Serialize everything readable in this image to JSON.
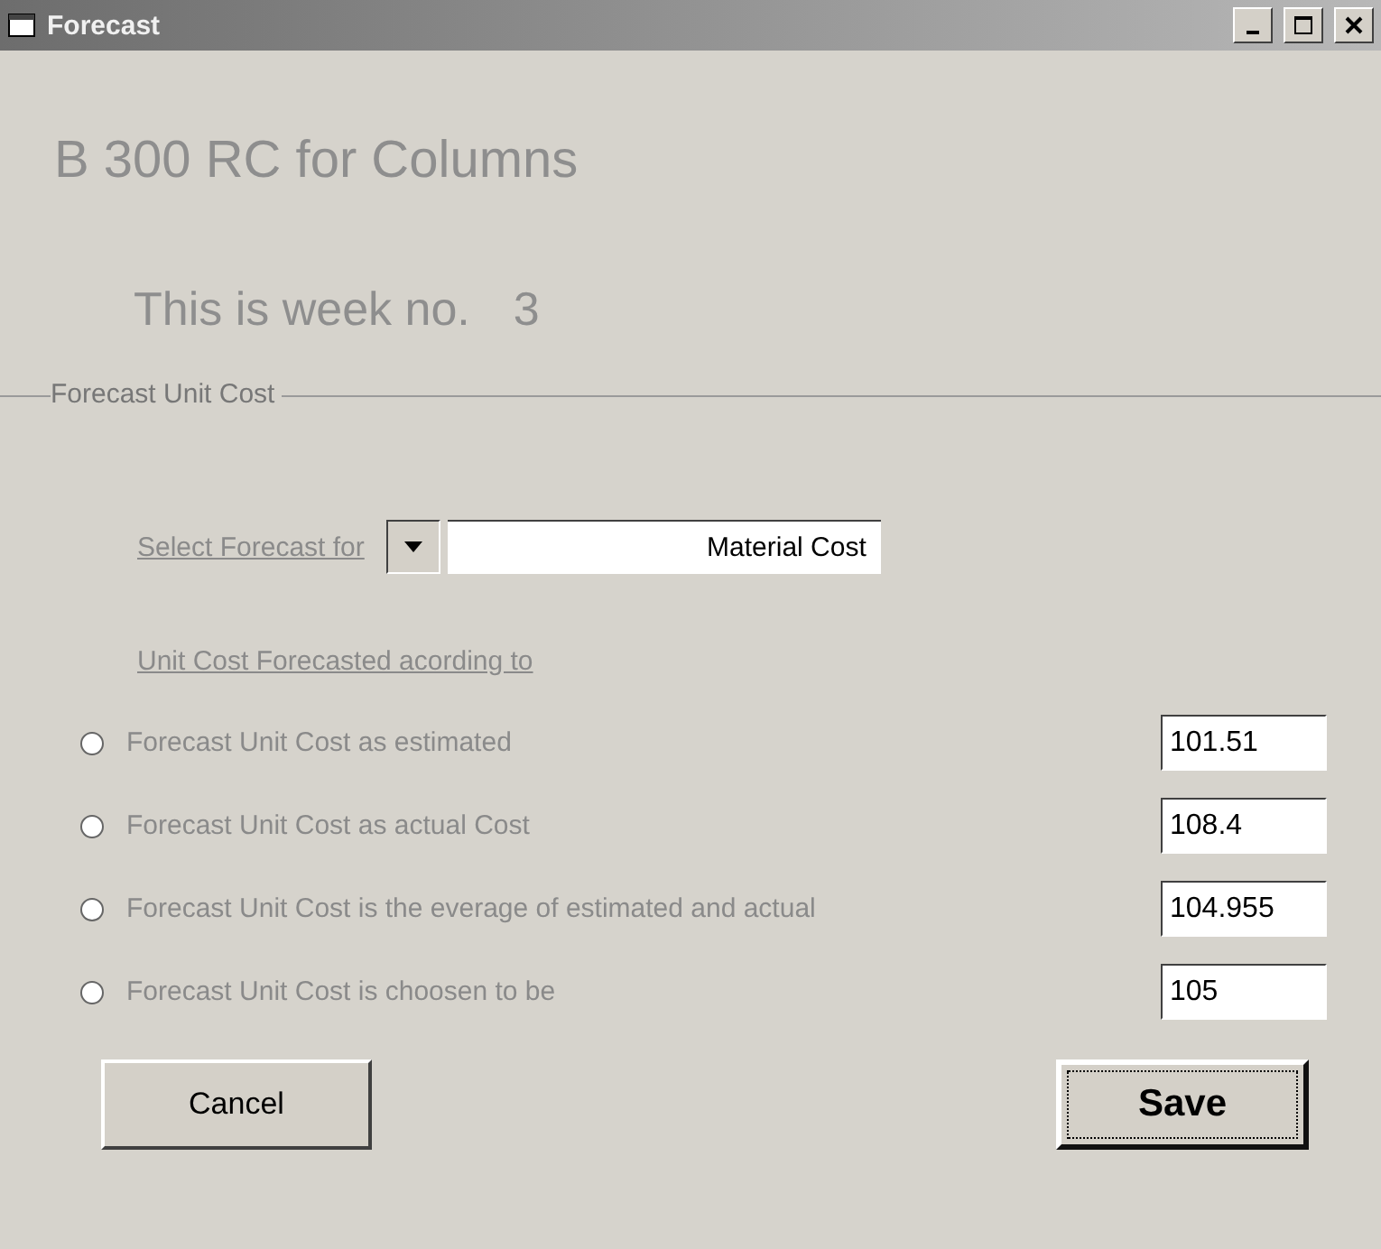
{
  "window": {
    "title": "Forecast"
  },
  "heading": "B 300 RC for Columns",
  "week": {
    "label": "This is week no.",
    "value": "3"
  },
  "group": {
    "title": "Forecast Unit Cost",
    "select": {
      "label": "Select Forecast for",
      "value": "Material Cost"
    },
    "options_label": "Unit Cost Forecasted acording to",
    "options": [
      {
        "label": "Forecast Unit Cost as estimated",
        "value": "101.51",
        "selected": false
      },
      {
        "label": "Forecast Unit Cost as actual Cost",
        "value": "108.4",
        "selected": false
      },
      {
        "label": "Forecast Unit Cost is the everage of estimated and actual",
        "value": "104.955",
        "selected": false
      },
      {
        "label": "Forecast Unit Cost is choosen to be",
        "value": "105",
        "selected": false
      }
    ]
  },
  "buttons": [
    {
      "label": "Cancel",
      "kind": "normal"
    },
    {
      "label": "Save",
      "kind": "default"
    }
  ]
}
